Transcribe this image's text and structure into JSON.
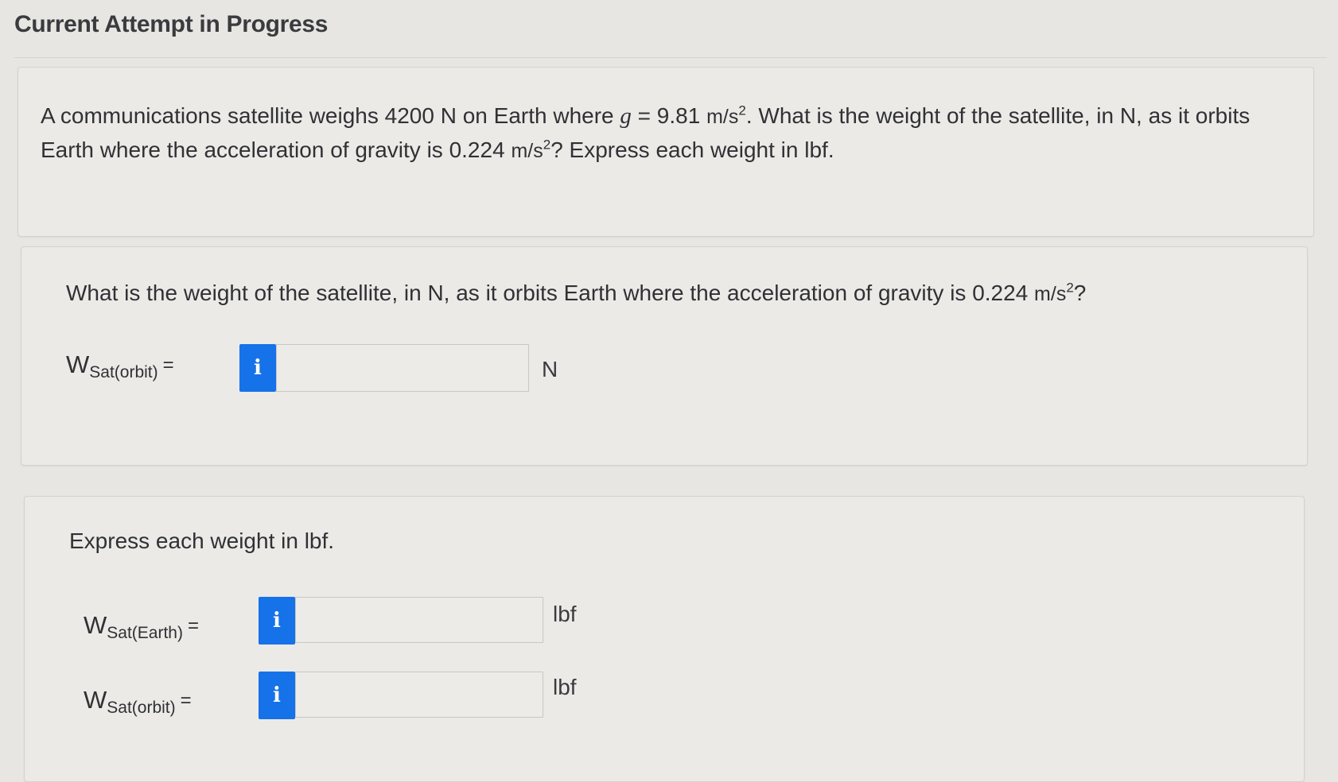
{
  "header": {
    "title": "Current Attempt in Progress"
  },
  "problem": {
    "t1": "A communications satellite weighs 4200 N on Earth where ",
    "g_symbol": "g",
    "t2": " = 9.81 ",
    "unit1": "m/s",
    "exp1": "2",
    "t3": ". What is the weight of the satellite, in N, as it orbits Earth where the acceleration of gravity is 0.224 ",
    "unit2": "m/s",
    "exp2": "2",
    "t4": "? Express each weight in lbf."
  },
  "part1": {
    "q_text": "What is the weight of the satellite, in N, as it orbits Earth where the acceleration of gravity is 0.224 ",
    "q_unit": "m/s",
    "q_exp": "2",
    "q_end": "?",
    "rows": [
      {
        "var": "W",
        "sub": "Sat(orbit)",
        "eq": "=",
        "info": "i",
        "value": "",
        "unit": "N"
      }
    ]
  },
  "part2": {
    "q_text": "Express each weight in lbf.",
    "rows": [
      {
        "var": "W",
        "sub": "Sat(Earth)",
        "eq": "=",
        "info": "i",
        "value": "",
        "unit": "lbf"
      },
      {
        "var": "W",
        "sub": "Sat(orbit)",
        "eq": "=",
        "info": "i",
        "value": "",
        "unit": "lbf"
      }
    ]
  },
  "colors": {
    "info_button": "#1572e8",
    "background": "#e7e6e3"
  }
}
